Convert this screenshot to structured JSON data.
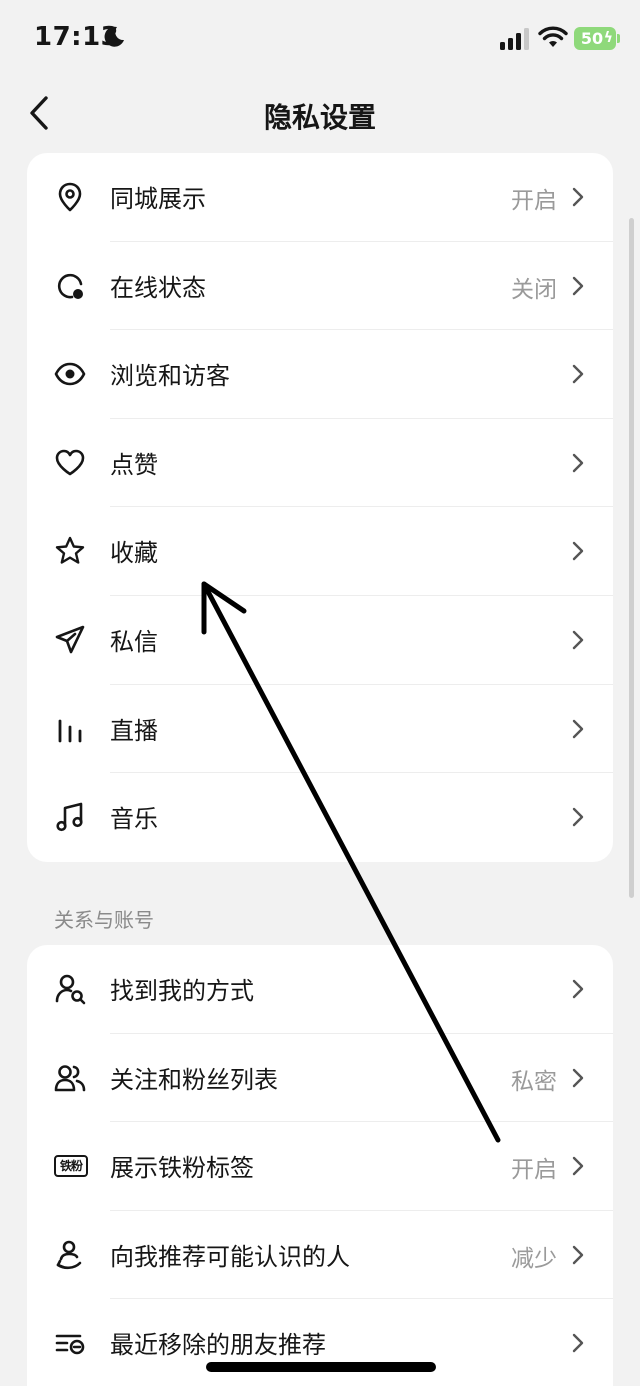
{
  "status_bar": {
    "time": "17:13",
    "battery": "50"
  },
  "nav": {
    "title": "隐私设置",
    "back_icon": "chevron-left-icon"
  },
  "privacy_items": [
    {
      "label": "同城展示",
      "value": "开启",
      "icon": "location-pin-icon"
    },
    {
      "label": "在线状态",
      "value": "关闭",
      "icon": "online-status-icon"
    },
    {
      "label": "浏览和访客",
      "value": "",
      "icon": "eye-icon"
    },
    {
      "label": "点赞",
      "value": "",
      "icon": "heart-icon"
    },
    {
      "label": "收藏",
      "value": "",
      "icon": "star-icon"
    },
    {
      "label": "私信",
      "value": "",
      "icon": "paper-plane-icon"
    },
    {
      "label": "直播",
      "value": "",
      "icon": "bars-icon"
    },
    {
      "label": "音乐",
      "value": "",
      "icon": "music-note-icon"
    }
  ],
  "section": {
    "title": "关系与账号"
  },
  "account_items": [
    {
      "label": "找到我的方式",
      "value": "",
      "icon": "user-search-icon"
    },
    {
      "label": "关注和粉丝列表",
      "value": "私密",
      "icon": "users-icon"
    },
    {
      "label": "展示铁粉标签",
      "value": "开启",
      "icon": "tiefen-badge-icon",
      "badge_text": "铁粉"
    },
    {
      "label": "向我推荐可能认识的人",
      "value": "减少",
      "icon": "recommend-user-icon"
    },
    {
      "label": "最近移除的朋友推荐",
      "value": "",
      "icon": "removed-list-icon"
    }
  ],
  "colors": {
    "background": "#f2f2f2",
    "card": "#ffffff",
    "secondary_text": "#9a9a9a",
    "battery": "#8fd97b"
  }
}
